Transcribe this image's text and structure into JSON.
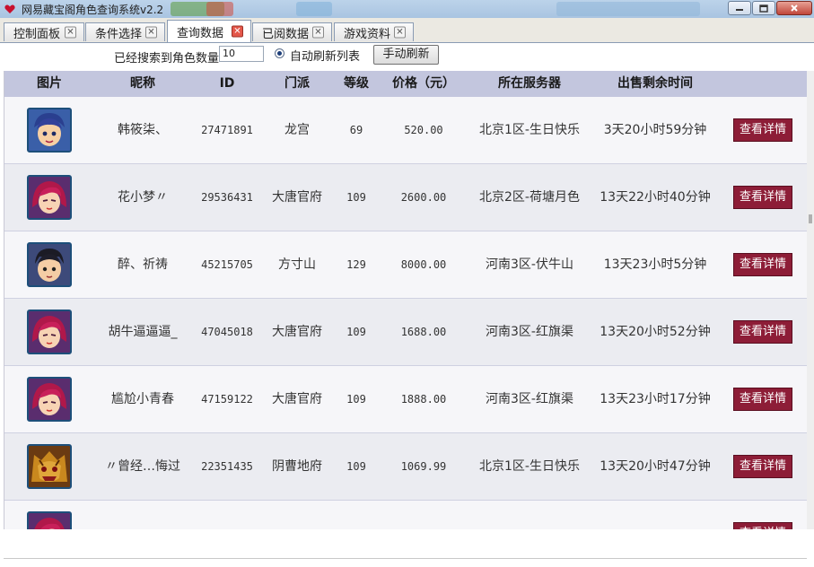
{
  "window": {
    "title": "网易藏宝阁角色查询系统v2.2"
  },
  "tabs": [
    {
      "label": "控制面板",
      "active": false
    },
    {
      "label": "条件选择",
      "active": false
    },
    {
      "label": "查询数据",
      "active": true
    },
    {
      "label": "已阅数据",
      "active": false
    },
    {
      "label": "游戏资料",
      "active": false
    }
  ],
  "toolbar": {
    "count_label": "已经搜索到角色数量",
    "count_value": "10",
    "auto_refresh_label": "自动刷新列表",
    "auto_refresh_checked": true,
    "manual_refresh_label": "手动刷新"
  },
  "table": {
    "headers": [
      "图片",
      "昵称",
      "ID",
      "门派",
      "等级",
      "价格（元）",
      "所在服务器",
      "出售剩余时间",
      ""
    ],
    "detail_button_label": "查看详情",
    "rows": [
      {
        "avatar": "avatar-boy-blue",
        "name": "韩筱柒、",
        "id": "27471891",
        "faction": "龙宫",
        "level": "69",
        "price": "520.00",
        "server": "北京1区-生日快乐",
        "time_left": "3天20小时59分钟"
      },
      {
        "avatar": "avatar-girl-red",
        "name": "花小梦〃",
        "id": "29536431",
        "faction": "大唐官府",
        "level": "109",
        "price": "2600.00",
        "server": "北京2区-荷塘月色",
        "time_left": "13天22小时40分钟"
      },
      {
        "avatar": "avatar-boy-black",
        "name": "醉、祈祷",
        "id": "45215705",
        "faction": "方寸山",
        "level": "129",
        "price": "8000.00",
        "server": "河南3区-伏牛山",
        "time_left": "13天23小时5分钟"
      },
      {
        "avatar": "avatar-girl-red",
        "name": "胡牛逼逼逼_",
        "id": "47045018",
        "faction": "大唐官府",
        "level": "109",
        "price": "1688.00",
        "server": "河南3区-红旗渠",
        "time_left": "13天20小时52分钟"
      },
      {
        "avatar": "avatar-girl-red",
        "name": "尴尬小青春",
        "id": "47159122",
        "faction": "大唐官府",
        "level": "109",
        "price": "1888.00",
        "server": "河南3区-红旗渠",
        "time_left": "13天23小时17分钟"
      },
      {
        "avatar": "avatar-tiger-gold",
        "name": "〃曾经…悔过",
        "id": "22351435",
        "faction": "阴曹地府",
        "level": "109",
        "price": "1069.99",
        "server": "北京1区-生日快乐",
        "time_left": "13天20小时47分钟"
      }
    ]
  },
  "colors": {
    "header_bg": "#c3c6de",
    "row_bg": "#f6f6f9",
    "row_alt_bg": "#ebecf1",
    "detail_button": "#8d1d37"
  },
  "icons": {
    "app": "heart-icon",
    "tab_close": "close-x-icon",
    "minimize": "minimize-icon",
    "maximize": "maximize-icon",
    "close": "close-icon"
  }
}
